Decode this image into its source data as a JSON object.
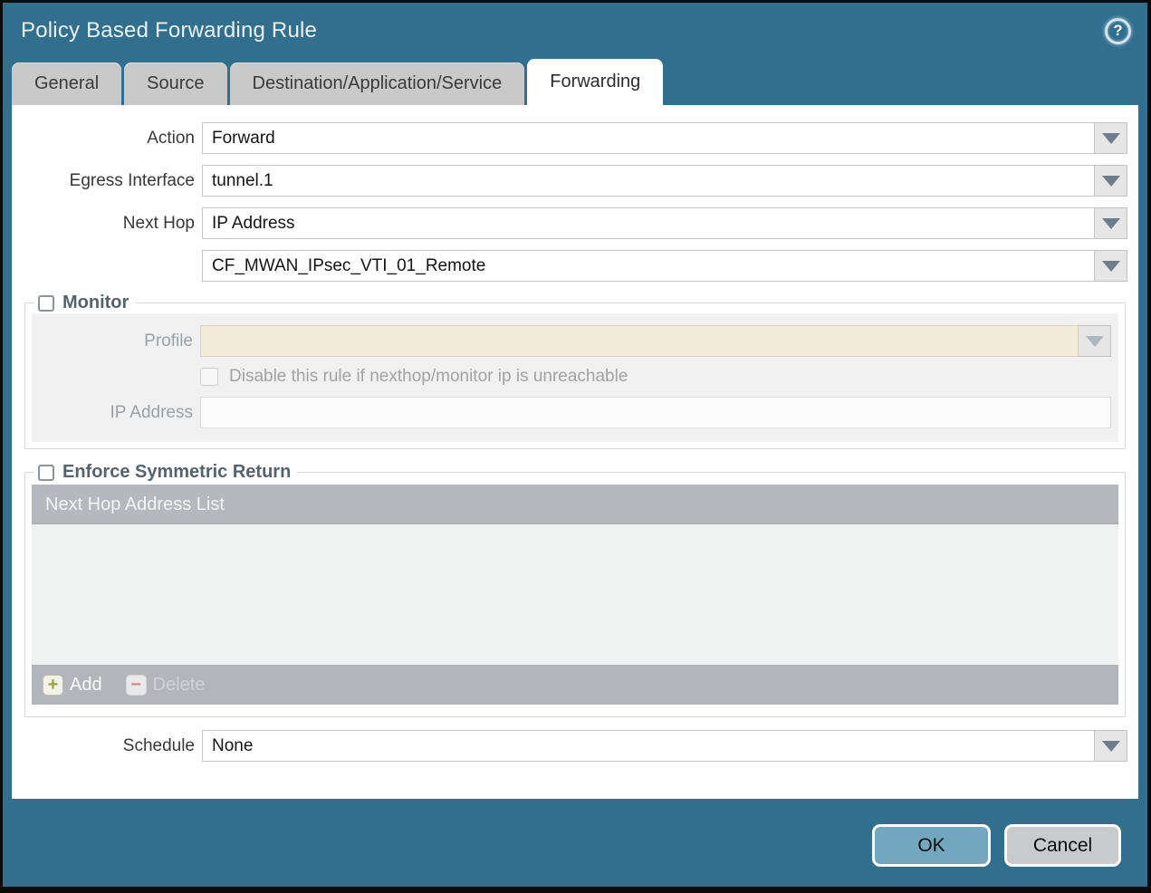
{
  "window": {
    "title": "Policy Based Forwarding Rule"
  },
  "icons": {
    "help": "?",
    "add_plus": "+",
    "delete_minus": "−"
  },
  "tabs": [
    {
      "label": "General",
      "active": false
    },
    {
      "label": "Source",
      "active": false
    },
    {
      "label": "Destination/Application/Service",
      "active": false
    },
    {
      "label": "Forwarding",
      "active": true
    }
  ],
  "form": {
    "action": {
      "label": "Action",
      "value": "Forward"
    },
    "egress_interface": {
      "label": "Egress Interface",
      "value": "tunnel.1"
    },
    "next_hop": {
      "label": "Next Hop",
      "value": "IP Address"
    },
    "next_hop_address": {
      "value": "CF_MWAN_IPsec_VTI_01_Remote"
    },
    "schedule": {
      "label": "Schedule",
      "value": "None"
    }
  },
  "monitor": {
    "title": "Monitor",
    "checked": false,
    "profile": {
      "label": "Profile",
      "value": ""
    },
    "disable_rule": {
      "label": "Disable this rule if nexthop/monitor ip is unreachable",
      "checked": false
    },
    "ip_address": {
      "label": "IP Address",
      "value": ""
    }
  },
  "symmetric_return": {
    "title": "Enforce Symmetric Return",
    "checked": false,
    "table": {
      "header": "Next Hop Address List",
      "rows": []
    },
    "buttons": {
      "add": "Add",
      "delete": "Delete",
      "delete_enabled": false
    }
  },
  "footer": {
    "ok_label": "OK",
    "cancel_label": "Cancel"
  },
  "colors": {
    "titlebar": "#326e8e",
    "tab_inactive": "#c9c9c9",
    "tab_active": "#ffffff",
    "field_disabled_beige": "#f3ecd9",
    "table_bar": "#b5b9bd",
    "ok_button": "#72a7bf",
    "cancel_button": "#c8cacc",
    "add_plus": "#95a33c",
    "delete_minus": "#d2888f"
  }
}
